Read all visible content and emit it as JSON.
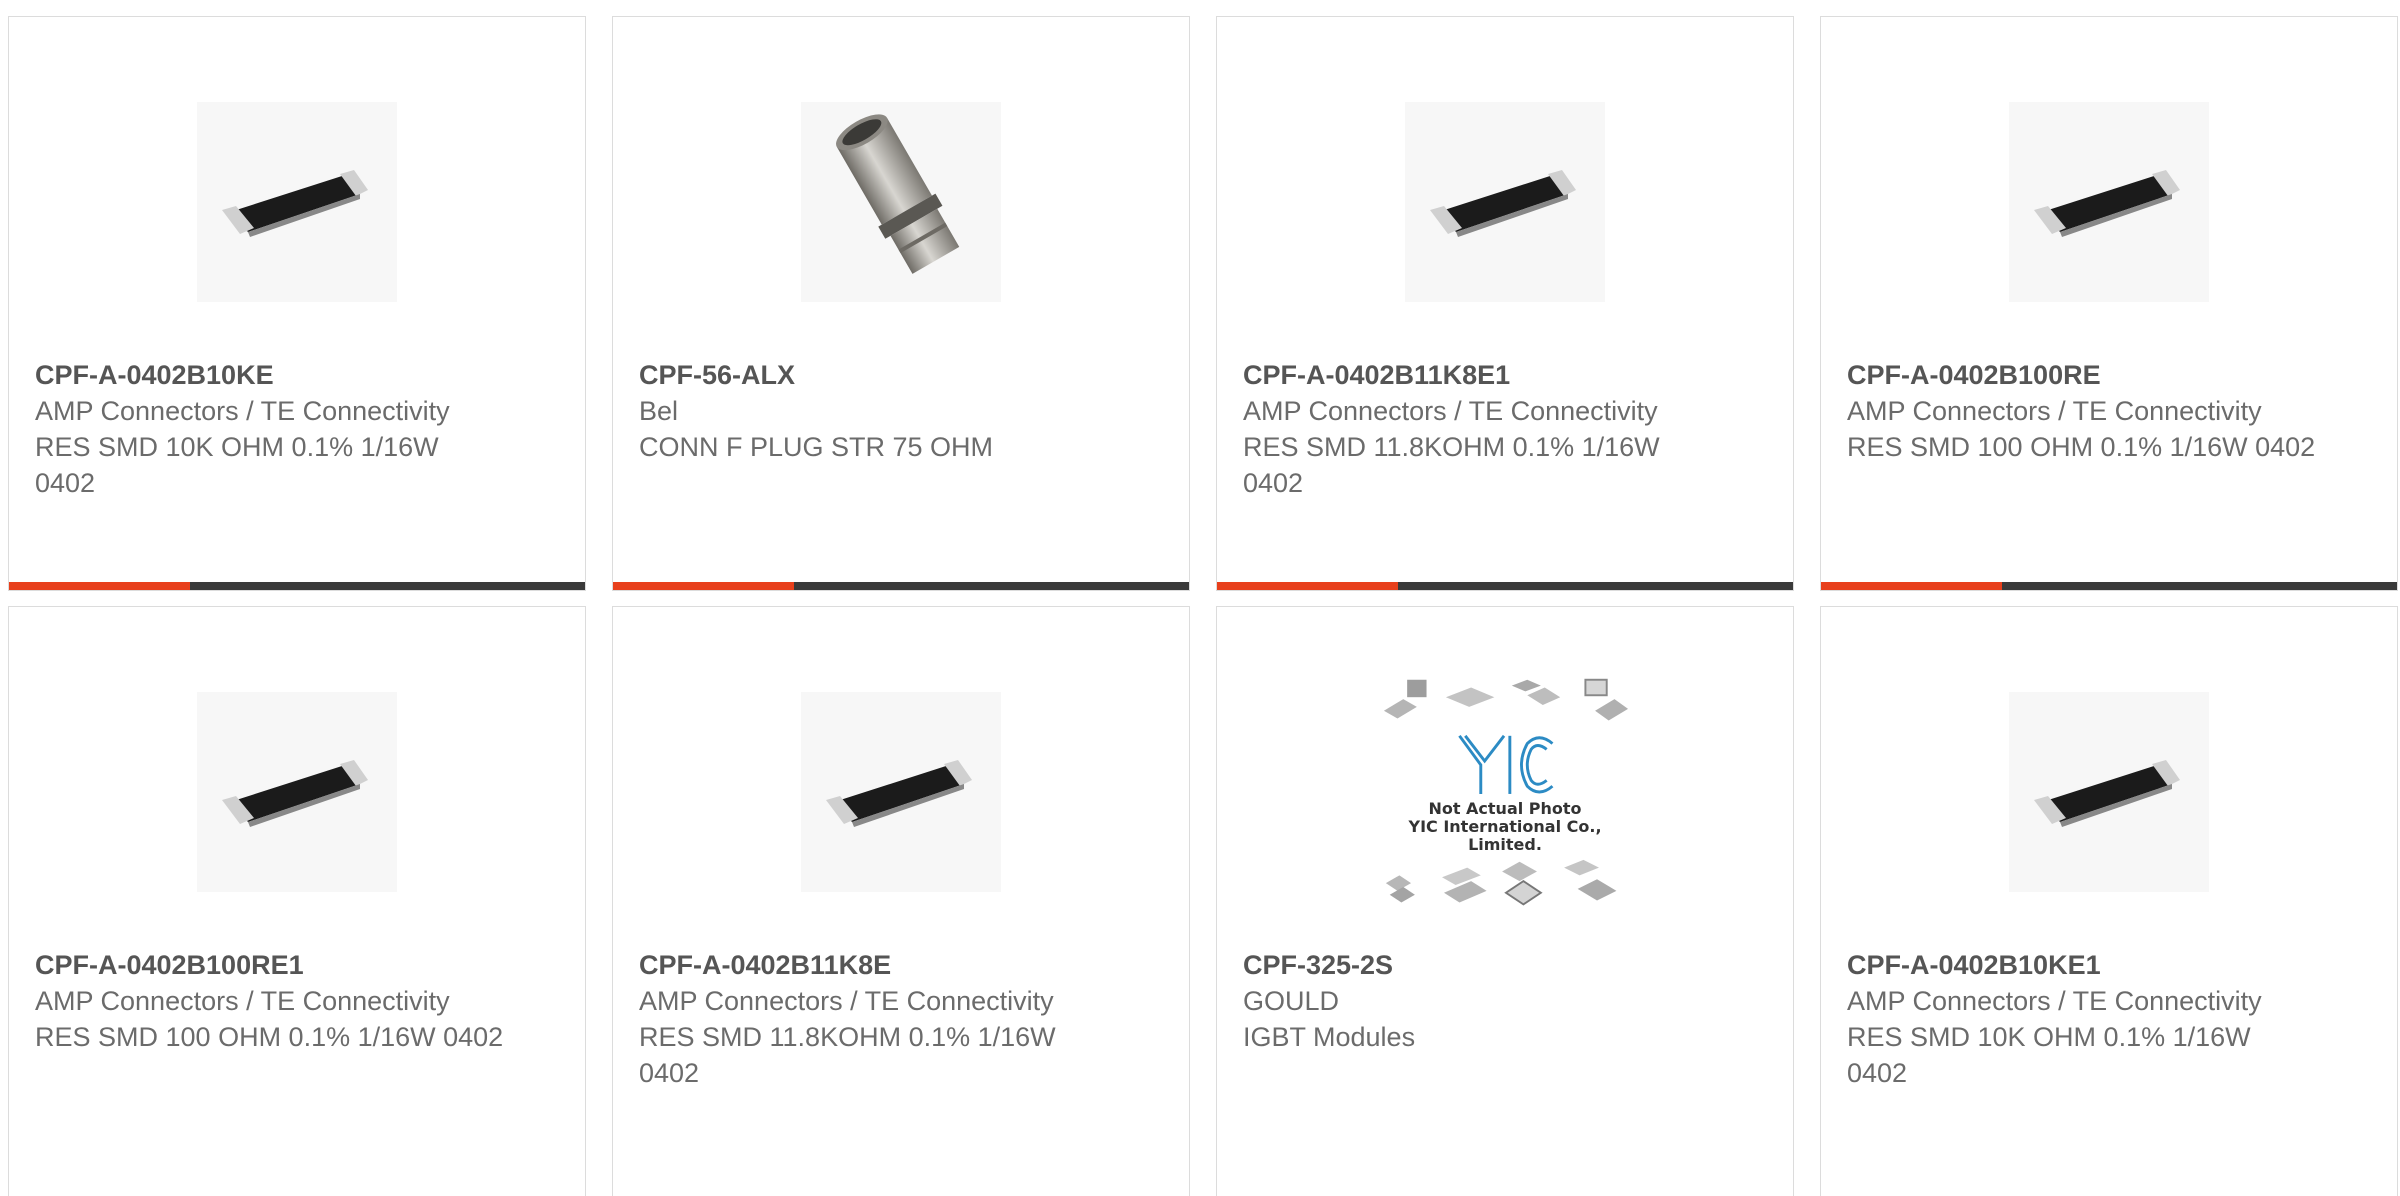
{
  "products": [
    {
      "part": "CPF-A-0402B10KE",
      "manufacturer": "AMP Connectors / TE Connectivity",
      "description": "RES SMD 10K OHM 0.1% 1/16W 0402",
      "image": "smd-resistor"
    },
    {
      "part": "CPF-56-ALX",
      "manufacturer": "Bel",
      "description": "CONN F PLUG STR 75 OHM",
      "image": "f-connector"
    },
    {
      "part": "CPF-A-0402B11K8E1",
      "manufacturer": "AMP Connectors / TE Connectivity",
      "description": "RES SMD 11.8KOHM 0.1% 1/16W 0402",
      "image": "smd-resistor"
    },
    {
      "part": "CPF-A-0402B100RE",
      "manufacturer": "AMP Connectors / TE Connectivity",
      "description": "RES SMD 100 OHM 0.1% 1/16W 0402",
      "image": "smd-resistor"
    },
    {
      "part": "CPF-A-0402B100RE1",
      "manufacturer": "AMP Connectors / TE Connectivity",
      "description": "RES SMD 100 OHM 0.1% 1/16W 0402",
      "image": "smd-resistor"
    },
    {
      "part": "CPF-A-0402B11K8E",
      "manufacturer": "AMP Connectors / TE Connectivity",
      "description": "RES SMD 11.8KOHM 0.1% 1/16W 0402",
      "image": "smd-resistor"
    },
    {
      "part": "CPF-325-2S",
      "manufacturer": "GOULD",
      "description": "IGBT Modules",
      "image": "placeholder-photo",
      "placeholder_text": [
        "Not Actual Photo",
        "YIC International Co., Limited."
      ],
      "placeholder_logo": "YIC"
    },
    {
      "part": "CPF-A-0402B10KE1",
      "manufacturer": "AMP Connectors / TE Connectivity",
      "description": "RES SMD 10K OHM 0.1% 1/16W 0402",
      "image": "smd-resistor"
    }
  ],
  "colors": {
    "accent": "#e8401c",
    "bar": "#3a3a3a",
    "text": "#555555"
  },
  "hover_bar_fraction": 0.315
}
